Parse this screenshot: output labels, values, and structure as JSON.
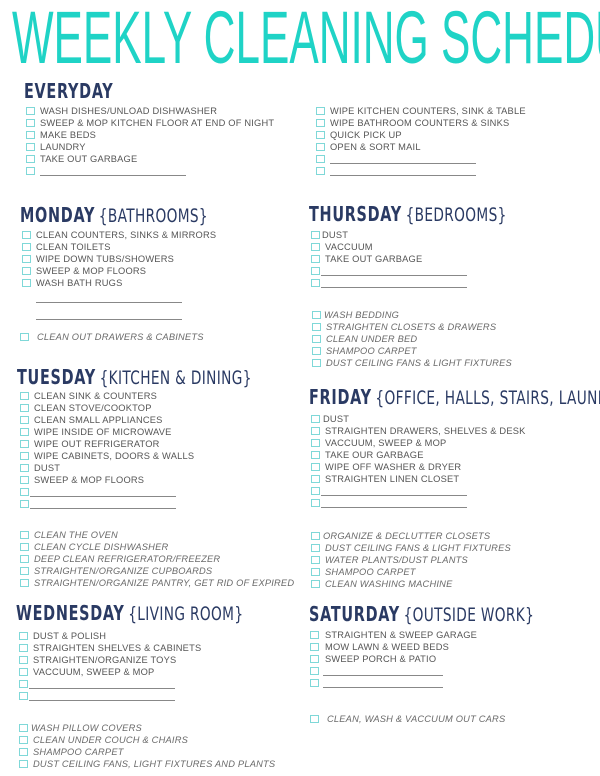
{
  "title": "WEEKLY CLEANING SCHEDULE",
  "colors": {
    "title": "#1fd3c6",
    "heading": "#2a3a63",
    "checkbox": "#7fd8d8",
    "text": "#555555"
  },
  "everyday": {
    "heading": "EVERYDAY",
    "left_tasks": [
      "WASH DISHES/UNLOAD DISHWASHER",
      "SWEEP & MOP KITCHEN FLOOR AT END OF NIGHT",
      "MAKE BEDS",
      "LAUNDRY",
      "TAKE OUT GARBAGE"
    ],
    "right_tasks": [
      "WIPE KITCHEN COUNTERS, SINK & TABLE",
      "WIPE BATHROOM COUNTERS & SINKS",
      "QUICK PICK UP",
      "OPEN & SORT MAIL"
    ]
  },
  "monday": {
    "day": "MONDAY",
    "room": "{BATHROOMS}",
    "tasks": [
      "CLEAN COUNTERS, SINKS & MIRRORS",
      "CLEAN TOILETS",
      "WIPE DOWN TUBS/SHOWERS",
      "SWEEP & MOP FLOORS",
      "WASH BATH RUGS"
    ],
    "extra": [
      "CLEAN OUT DRAWERS & CABINETS"
    ]
  },
  "tuesday": {
    "day": "TUESDAY",
    "room": "{KITCHEN & DINING}",
    "tasks": [
      "CLEAN SINK & COUNTERS",
      "CLEAN STOVE/COOKTOP",
      "CLEAN SMALL APPLIANCES",
      "WIPE INSIDE OF MICROWAVE",
      "WIPE OUT REFRIGERATOR",
      "WIPE CABINETS, DOORS & WALLS",
      "DUST",
      "SWEEP & MOP FLOORS"
    ],
    "extra": [
      "CLEAN THE OVEN",
      "CLEAN CYCLE DISHWASHER",
      "DEEP CLEAN REFRIGERATOR/FREEZER",
      "STRAIGHTEN/ORGANIZE CUPBOARDS",
      "STRAIGHTEN/ORGANIZE PANTRY, GET RID OF EXPIRED"
    ]
  },
  "wednesday": {
    "day": "WEDNESDAY",
    "room": "{LIVING ROOM}",
    "tasks": [
      "DUST & POLISH",
      "STRAIGHTEN SHELVES & CABINETS",
      "STRAIGHTEN/ORGANIZE TOYS",
      "VACCUUM, SWEEP & MOP"
    ],
    "extra": [
      "WASH PILLOW COVERS",
      "CLEAN UNDER COUCH  & CHAIRS",
      "SHAMPOO CARPET",
      "DUST CEILING FANS, LIGHT FIXTURES AND PLANTS"
    ]
  },
  "thursday": {
    "day": "THURSDAY",
    "room": "{BEDROOMS}",
    "tasks": [
      "DUST",
      "VACCUUM",
      "TAKE OUT GARBAGE"
    ],
    "extra": [
      "WASH BEDDING",
      "STRAIGHTEN CLOSETS & DRAWERS",
      "CLEAN UNDER BED",
      "SHAMPOO CARPET",
      "DUST CEILING FANS & LIGHT FIXTURES"
    ]
  },
  "friday": {
    "day": "FRIDAY",
    "room": "{OFFICE, HALLS, STAIRS, LAUNDRY}",
    "tasks": [
      "DUST",
      "STRAIGHTEN DRAWERS, SHELVES & DESK",
      "VACCUUM, SWEEP & MOP",
      "TAKE OUR GARBAGE",
      "WIPE OFF WASHER & DRYER",
      "STRAIGHTEN LINEN CLOSET"
    ],
    "extra": [
      "ORGANIZE & DECLUTTER CLOSETS",
      "DUST CEILING FANS & LIGHT FIXTURES",
      "WATER  PLANTS/DUST PLANTS",
      "SHAMPOO CARPET",
      "CLEAN WASHING MACHINE"
    ]
  },
  "saturday": {
    "day": "SATURDAY",
    "room": "{OUTSIDE WORK}",
    "tasks": [
      "STRAIGHTEN & SWEEP GARAGE",
      "MOW LAWN & WEED BEDS",
      "SWEEP PORCH & PATIO"
    ],
    "extra": [
      "CLEAN, WASH & VACCUUM OUT CARS"
    ]
  }
}
